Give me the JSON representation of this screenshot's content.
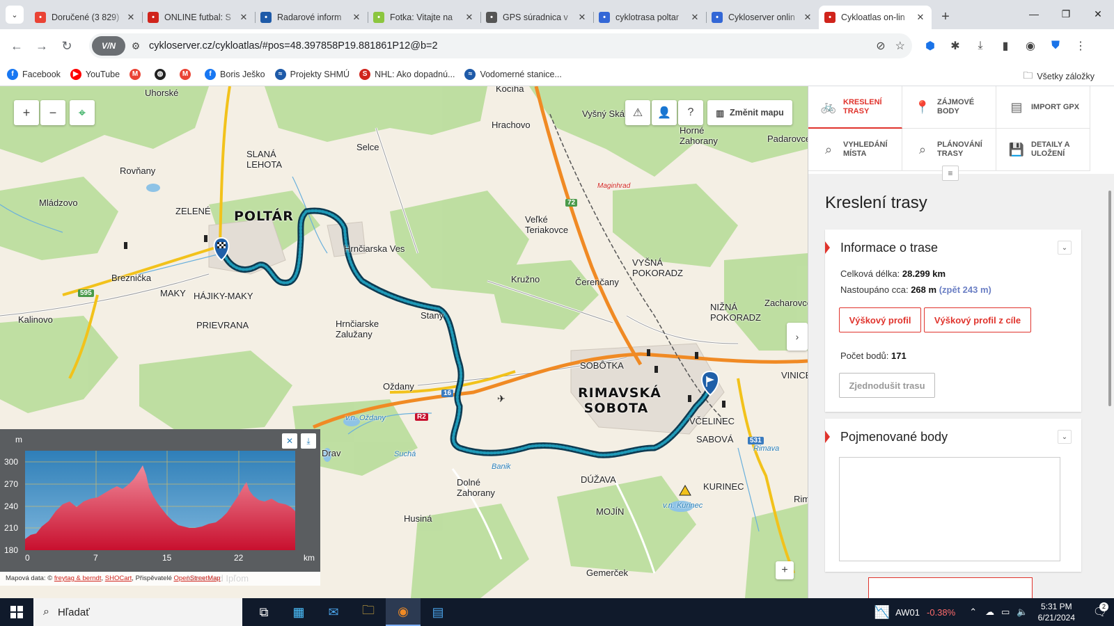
{
  "browser": {
    "tabs": [
      {
        "title": "Doručené (3 829)",
        "icon": "gmail-icon",
        "color": "#ea4335",
        "active": false
      },
      {
        "title": "ONLINE futbal: S",
        "icon": "sport-icon",
        "color": "#d0241c",
        "active": false
      },
      {
        "title": "Radarové inform",
        "icon": "shmu-icon",
        "color": "#1e5aa8",
        "active": false
      },
      {
        "title": "Fotka: Vitajte na",
        "icon": "h-icon",
        "color": "#8cc63f",
        "active": false
      },
      {
        "title": "GPS súradnica v",
        "icon": "gps-icon",
        "color": "#555555",
        "active": false
      },
      {
        "title": "cyklotrasa poltar",
        "icon": "search-icon",
        "color": "#3367d6",
        "active": false
      },
      {
        "title": "Cykloserver onlin",
        "icon": "search-icon",
        "color": "#3367d6",
        "active": false
      },
      {
        "title": "Cykloatlas on-lin",
        "icon": "bike-icon",
        "color": "#d0241c",
        "active": true
      }
    ],
    "url": "cykloserver.cz/cykloatlas/#pos=48.397858P19.881861P12@b=2",
    "vpn_label": "V/N",
    "bookmarks": [
      {
        "label": "Facebook",
        "icon": "facebook-icon",
        "color": "#1877f2",
        "glyph": "f"
      },
      {
        "label": "YouTube",
        "icon": "youtube-icon",
        "color": "#ff0000",
        "glyph": "▶"
      },
      {
        "label": "",
        "icon": "gmail-icon",
        "color": "#ea4335",
        "glyph": "M"
      },
      {
        "label": "",
        "icon": "globe-icon",
        "color": "#222222",
        "glyph": "◍"
      },
      {
        "label": "",
        "icon": "gmail-icon",
        "color": "#ea4335",
        "glyph": "M"
      },
      {
        "label": "Boris Ješko",
        "icon": "facebook-icon",
        "color": "#1877f2",
        "glyph": "f"
      },
      {
        "label": "Projekty SHMÚ",
        "icon": "shmu-icon",
        "color": "#1e5aa8",
        "glyph": "≈"
      },
      {
        "label": "NHL: Ako dopadnú...",
        "icon": "sport-icon",
        "color": "#d0241c",
        "glyph": "S"
      },
      {
        "label": "Vodomerné stanice...",
        "icon": "shmu-icon",
        "color": "#1e5aa8",
        "glyph": "≈"
      }
    ],
    "all_bookmarks": "Všetky záložky"
  },
  "map": {
    "labels": [
      {
        "text": "Uhorské",
        "cls": ""
      },
      {
        "text": "Kocíha",
        "cls": ""
      },
      {
        "text": "Hrachovo",
        "cls": ""
      },
      {
        "text": "Vyšný Skálnik",
        "cls": ""
      },
      {
        "text": "Horné Zahorany",
        "cls": ""
      },
      {
        "text": "Padarovce",
        "cls": ""
      },
      {
        "text": "Selce",
        "cls": ""
      },
      {
        "text": "SLANÁ LEHOTA",
        "cls": ""
      },
      {
        "text": "Rovňany",
        "cls": ""
      },
      {
        "text": "Mládzovo",
        "cls": ""
      },
      {
        "text": "ZELENÉ",
        "cls": ""
      },
      {
        "text": "POLTÁR",
        "cls": "big"
      },
      {
        "text": "Hrnčiarska Ves",
        "cls": ""
      },
      {
        "text": "Veľké Teriakovce",
        "cls": ""
      },
      {
        "text": "Breznička",
        "cls": ""
      },
      {
        "text": "MAKY",
        "cls": ""
      },
      {
        "text": "HÁJIKY-MAKY",
        "cls": ""
      },
      {
        "text": "PRIEVRANA",
        "cls": ""
      },
      {
        "text": "Kalinovo",
        "cls": ""
      },
      {
        "text": "Kružno",
        "cls": ""
      },
      {
        "text": "Čerenčany",
        "cls": ""
      },
      {
        "text": "VYŠNÁ POKORADZ",
        "cls": ""
      },
      {
        "text": "NIŽNÁ POKORADZ",
        "cls": ""
      },
      {
        "text": "Zacharovce",
        "cls": ""
      },
      {
        "text": "Stany",
        "cls": ""
      },
      {
        "text": "Hrnčiarske Zalužany",
        "cls": ""
      },
      {
        "text": "SOBÔTKA",
        "cls": ""
      },
      {
        "text": "Oždany",
        "cls": ""
      },
      {
        "text": "RIMAVSKÁ SOBOTA",
        "cls": "big"
      },
      {
        "text": "VINICE",
        "cls": ""
      },
      {
        "text": "VČELINEC",
        "cls": ""
      },
      {
        "text": "SABOVÁ",
        "cls": ""
      },
      {
        "text": "Dolné Zahorany",
        "cls": ""
      },
      {
        "text": "DÚŽAVA",
        "cls": ""
      },
      {
        "text": "KURINEC",
        "cls": ""
      },
      {
        "text": "MOJÍN",
        "cls": ""
      },
      {
        "text": "Husiná",
        "cls": ""
      },
      {
        "text": "Gemerček",
        "cls": ""
      },
      {
        "text": "Maginhrad",
        "cls": "red"
      },
      {
        "text": "Banik",
        "cls": "water"
      },
      {
        "text": "Suchá",
        "cls": "water"
      },
      {
        "text": "Rimava",
        "cls": "water"
      },
      {
        "text": "v.n. Kurinec",
        "cls": "water"
      },
      {
        "text": "v.n. Oždany",
        "cls": "water"
      },
      {
        "text": "Drav",
        "cls": ""
      },
      {
        "text": "Rim Ja",
        "cls": ""
      },
      {
        "text": "Nitra nad Ipľom",
        "cls": ""
      }
    ],
    "road_numbers": [
      "72",
      "595",
      "16",
      "R2",
      "531"
    ],
    "controls": {
      "zoom_in": "+",
      "zoom_out": "−",
      "change_map": "Změnit mapu"
    }
  },
  "elevation": {
    "unit": "m",
    "y_ticks": [
      "300",
      "270",
      "240",
      "210",
      "180"
    ],
    "x_ticks": [
      "0",
      "7",
      "15",
      "22",
      "km"
    ]
  },
  "attribution": {
    "prefix": "Mapová data: ©",
    "link1": "freytag & berndt",
    "sep": ",",
    "link2": "SHOCart",
    "mid": ", Přispěvatelé",
    "link3": "OpenStreetMap"
  },
  "panel": {
    "menu": [
      {
        "label": "KRESLENÍ TRASY",
        "icon": "bike-icon",
        "active": true
      },
      {
        "label": "ZÁJMOVÉ BODY",
        "icon": "pin-icon",
        "active": false
      },
      {
        "label": "IMPORT GPX",
        "icon": "file-icon",
        "active": false
      },
      {
        "label": "VYHLEDÁNÍ MÍSTA",
        "icon": "search-icon",
        "active": false
      },
      {
        "label": "PLÁNOVÁNÍ TRASY",
        "icon": "search-icon",
        "active": false
      },
      {
        "label": "DETAILY A ULOŽENÍ",
        "icon": "save-icon",
        "active": false
      }
    ],
    "title": "Kreslení trasy",
    "route_info": {
      "heading": "Informace o trase",
      "length_label": "Celková délka:",
      "length_value": "28.299 km",
      "climb_label": "Nastoupáno cca:",
      "climb_value": "268 m",
      "climb_back": "(zpět 243 m)",
      "profile_btn": "Výškový profil",
      "profile_end_btn": "Výškový profil z cíle",
      "points_label": "Počet bodů:",
      "points_value": "171",
      "simplify_btn": "Zjednodušit trasu"
    },
    "named_points": {
      "heading": "Pojmenované body"
    }
  },
  "taskbar": {
    "search_placeholder": "Hľadať",
    "stock_name": "AW01",
    "stock_change": "-0.38%",
    "time": "5:31 PM",
    "date": "6/21/2024",
    "notif_count": "2"
  }
}
